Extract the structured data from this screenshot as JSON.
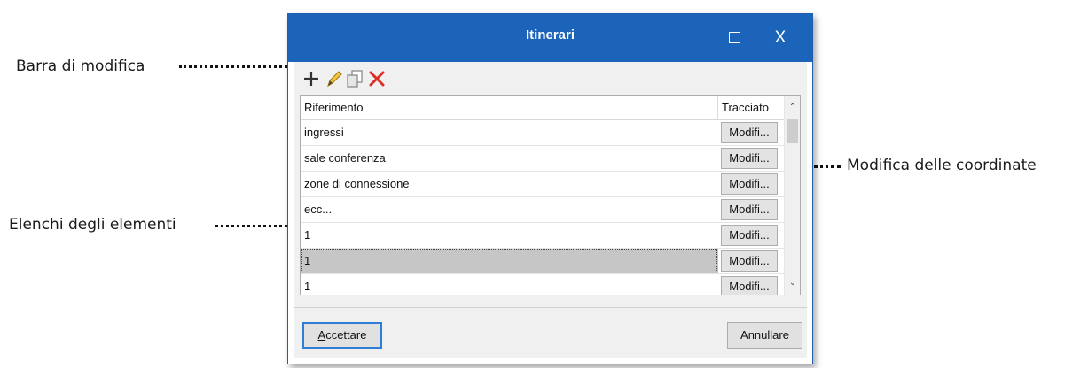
{
  "annotations": {
    "edit_bar": "Barra di modifica",
    "element_lists": "Elenchi degli elementi",
    "edit_coordinates": "Modifica delle coordinate"
  },
  "window": {
    "title": "Itinerari",
    "maximize_label": "",
    "close_label": "X"
  },
  "toolbar": {
    "add_icon": "plus-icon",
    "edit_icon": "pencil-icon",
    "copy_icon": "copy-icon",
    "delete_icon": "delete-x-icon",
    "colors": {
      "add": "#333333",
      "edit": "#d4a017",
      "copy": "#8a8a8a",
      "delete": "#d93025"
    }
  },
  "table": {
    "columns": [
      "Riferimento",
      "Tracciato"
    ],
    "rows": [
      {
        "riferimento": "ingressi",
        "action": "Modifi..."
      },
      {
        "riferimento": "sale conferenza",
        "action": "Modifi..."
      },
      {
        "riferimento": "zone di connessione",
        "action": "Modifi..."
      },
      {
        "riferimento": "ecc...",
        "action": "Modifi..."
      },
      {
        "riferimento": "1",
        "action": "Modifi..."
      },
      {
        "riferimento": "1",
        "action": "Modifi...",
        "selected": true
      },
      {
        "riferimento": "1",
        "action": "Modifi..."
      }
    ]
  },
  "footer": {
    "accept_mnemonic": "A",
    "accept_rest": "ccettare",
    "cancel_label": "Annullare"
  },
  "colors": {
    "titlebar": "#1c64b9",
    "focus_border": "#2d7ed4",
    "selection": "#c6c6c6"
  }
}
